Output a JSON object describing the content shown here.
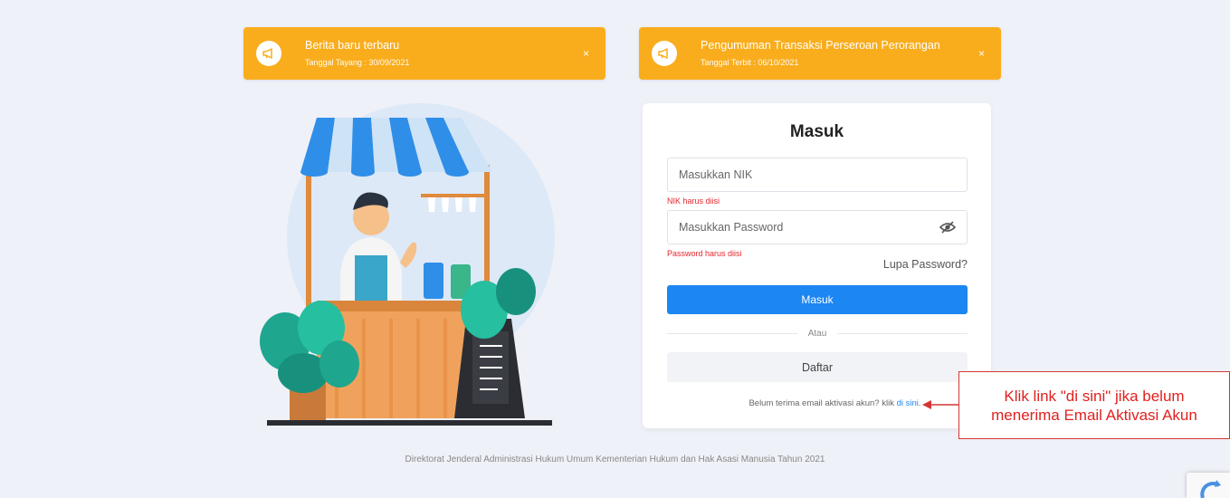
{
  "notifications": [
    {
      "title": "Berita baru terbaru",
      "subtitle": "Tanggal Tayang : 30/09/2021",
      "close": "×",
      "icon": "megaphone-icon"
    },
    {
      "title": "Pengumuman Transaksi Perseroan Perorangan",
      "subtitle": "Tanggal Terbit : 06/10/2021",
      "close": "×",
      "icon": "megaphone-icon"
    }
  ],
  "login": {
    "title": "Masuk",
    "nik_placeholder": "Masukkan NIK",
    "nik_error": "NIK harus diisi",
    "password_placeholder": "Masukkan Password",
    "password_error": "Password harus diisi",
    "forgot": "Lupa Password?",
    "submit": "Masuk",
    "divider": "Atau",
    "register": "Daftar",
    "activation_text": "Belum terima email aktivasi akun? klik ",
    "activation_link": "di sini",
    "activation_end": "."
  },
  "callout": {
    "line1": "Klik link \"di sini\" jika belum",
    "line2": "menerima Email Aktivasi Akun"
  },
  "footer": "Direktorat Jenderal Administrasi Hukum Umum Kementerian Hukum dan Hak Asasi Manusia Tahun 2021",
  "colors": {
    "notification": "#f9ad1d",
    "primary": "#1c86f2",
    "error": "#e4262c",
    "callout": "#e0211f"
  }
}
